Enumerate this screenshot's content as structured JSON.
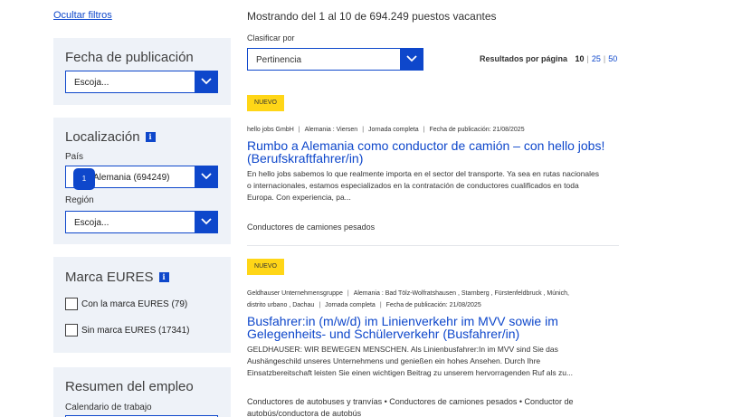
{
  "filters": {
    "hide_link": "Ocultar filtros",
    "date_panel": {
      "title": "Fecha de publicación",
      "select_value": "Escoja..."
    },
    "location_panel": {
      "title": "Localización",
      "info": "i",
      "country_label": "País",
      "country_value": "Alemania (694249)",
      "country_badge": "1",
      "region_label": "Región",
      "region_value": "Escoja..."
    },
    "eures_panel": {
      "title": "Marca EURES",
      "info": "i",
      "options": [
        {
          "label": "Con la marca EURES (79)",
          "checked": false
        },
        {
          "label": "Sin marca EURES (17341)",
          "checked": false
        }
      ]
    },
    "summary_panel": {
      "title": "Resumen del empleo",
      "calendar_label": "Calendario de trabajo"
    }
  },
  "results": {
    "count_text": "Mostrando del 1 al 10 de 694.249 puestos vacantes",
    "sort_label": "Clasificar por",
    "sort_value": "Pertinencia",
    "per_page_label": "Resultados por página",
    "per_page_options": [
      "10",
      "25",
      "50"
    ],
    "per_page_selected": "10"
  },
  "jobs": [
    {
      "badge": "NUEVO",
      "meta_line1": [
        "hello jobs GmbH",
        "Alemania : Viersen",
        "Jornada completa",
        "Fecha de publicación: 21/08/2025"
      ],
      "meta_line2": [],
      "title": "Rumbo a Alemania como conductor de camión – con hello jobs! (Berufskraftfahrer/in)",
      "description": "En hello jobs sabemos lo que realmente importa en el sector del transporte.   Ya sea en rutas nacionales o internacionales, estamos especializados en la contratación de conductores cualificados en toda Europa.  Con experiencia, pa...",
      "categories": [
        "Conductores de camiones pesados"
      ]
    },
    {
      "badge": "NUEVO",
      "meta_line1": [
        "Geldhauser Unternehmensgruppe",
        "Alemania : Bad Tölz-Wolfratshausen , Starnberg , Fürstenfeldbruck , Múnich,"
      ],
      "meta_line2": [
        "distrito urbano , Dachau",
        "Jornada completa",
        "Fecha de publicación: 21/08/2025"
      ],
      "title": "Busfahrer:in (m/w/d) im Linienverkehr im MVV sowie im Gelegenheits- und Schülerverkehr (Busfahrer/in)",
      "description": "GELDHAUSER: WIR BEWEGEN MENSCHEN. Als Linienbusfahrer:In im MVV sind Sie das Aushängeschild unseres Unternehmens und genießen ein hohes Ansehen. Durch Ihre Einsatzbereitschaft leisten Sie einen wichtigen Beitrag zu unserem hervorragenden Ruf als zu...",
      "categories": [
        "Conductores de autobuses y tranvías",
        "Conductores de camiones pesados",
        "Conductor de autobús/conductora de autobús"
      ]
    }
  ]
}
